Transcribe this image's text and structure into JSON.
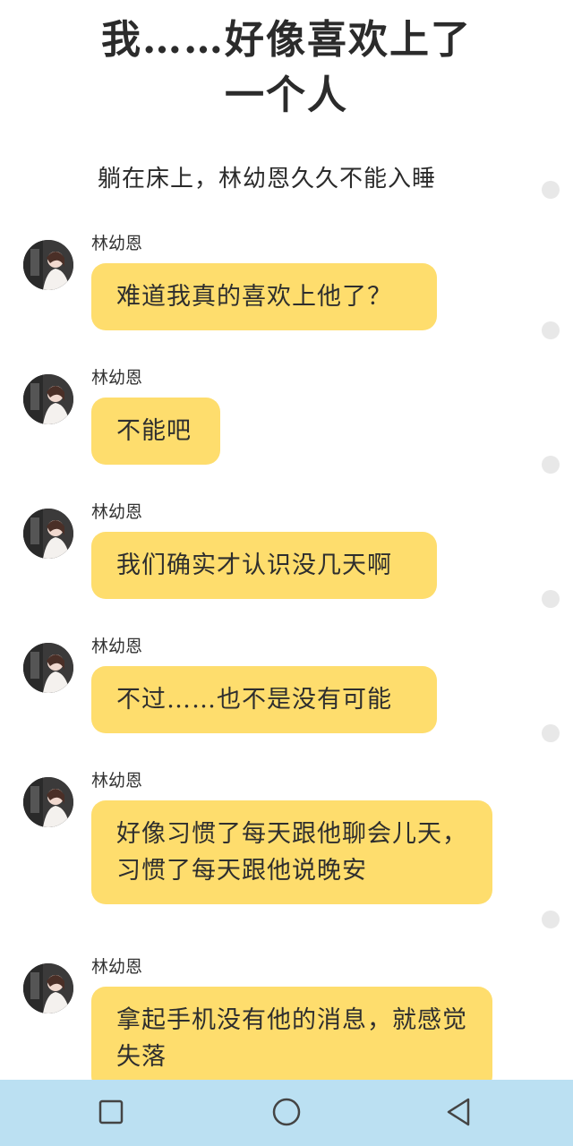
{
  "story": {
    "title_line1": "我……好像喜欢上了",
    "title_line2": "一个人",
    "subtitle": "躺在床上，林幼恩久久不能入睡"
  },
  "messages": [
    {
      "sender": "林幼恩",
      "text": "难道我真的喜欢上他了？"
    },
    {
      "sender": "林幼恩",
      "text": "不能吧"
    },
    {
      "sender": "林幼恩",
      "text": "我们确实才认识没几天啊"
    },
    {
      "sender": "林幼恩",
      "text": "不过……也不是没有可能"
    },
    {
      "sender": "林幼恩",
      "text": "好像习惯了每天跟他聊会儿天，习惯了每天跟他说晚安"
    },
    {
      "sender": "林幼恩",
      "text": "拿起手机没有他的消息，就感觉失落"
    }
  ],
  "navbar": {
    "icons": [
      "square-recents-icon",
      "circle-home-icon",
      "triangle-back-icon"
    ]
  },
  "colors": {
    "bubble": "#fedd6d",
    "navbar": "#bbe0f2",
    "background": "#ffffff"
  }
}
